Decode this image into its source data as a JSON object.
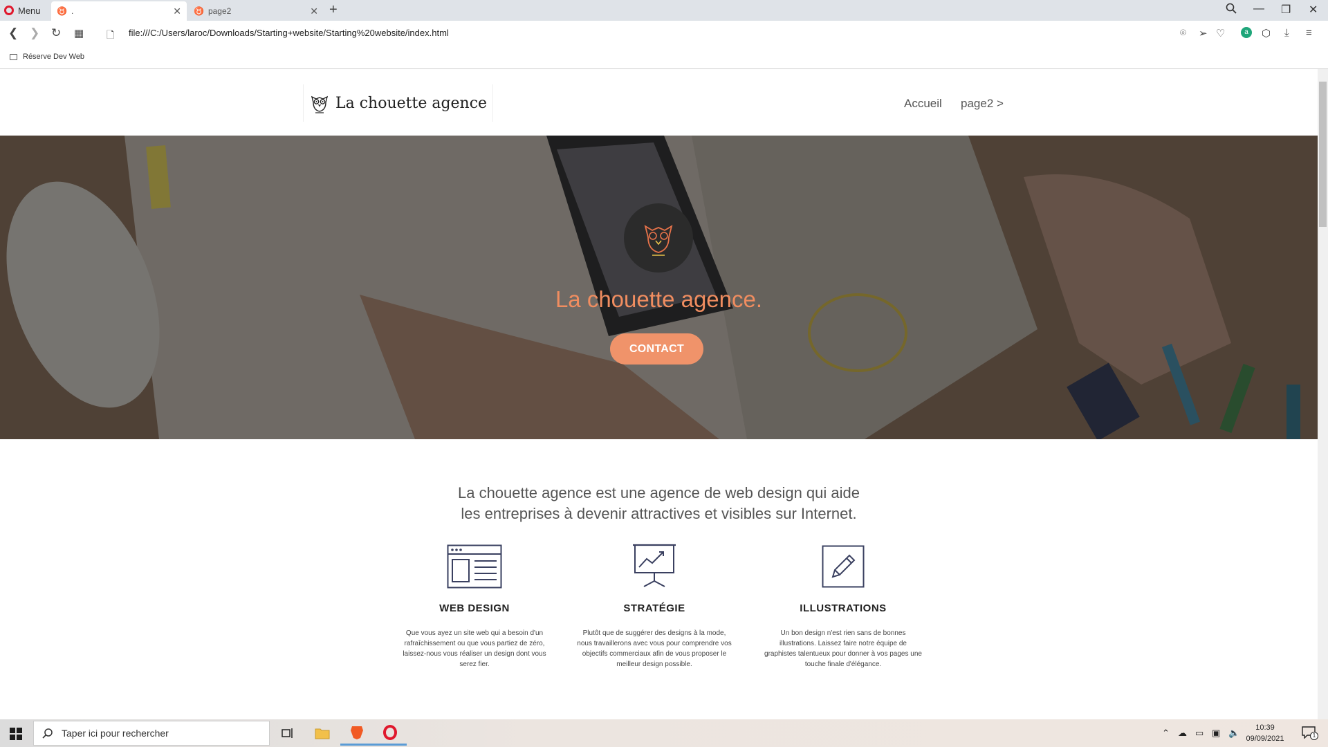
{
  "browser": {
    "menu_label": "Menu",
    "tabs": [
      {
        "title": ".",
        "active": true
      },
      {
        "title": "page2",
        "active": false
      }
    ],
    "url": "file:///C:/Users/laroc/Downloads/Starting+website/Starting%20website/index.html",
    "bookmarks": [
      {
        "label": "Réserve Dev Web"
      }
    ],
    "icons": {
      "back": "back-arrow-icon",
      "forward": "forward-arrow-icon",
      "reload": "reload-icon",
      "tabs_overview": "grid-icon",
      "page": "page-icon",
      "snapshot": "camera-icon",
      "send": "send-icon",
      "bookmark": "heart-icon",
      "vpn": "extension-icon",
      "box": "cube-icon",
      "download": "download-icon",
      "menu": "menu-icon",
      "search": "search-icon",
      "minimize": "minimize-icon",
      "restore": "restore-icon",
      "close": "close-icon"
    }
  },
  "site": {
    "logo_text": "La chouette agence",
    "nav": [
      {
        "label": "Accueil"
      },
      {
        "label": "page2 >"
      }
    ],
    "hero": {
      "title": "La chouette agence.",
      "cta": "CONTACT",
      "accent_color": "#f0936a"
    },
    "intro": {
      "line1": "La chouette agence est une agence de web design qui aide",
      "line2": "les entreprises à devenir attractives et visibles sur Internet."
    },
    "services": [
      {
        "icon": "web-layout-icon",
        "title": "WEB DESIGN",
        "desc": "Que vous ayez un site web qui a besoin d'un rafraîchissement ou que vous partiez de zéro, laissez-nous vous réaliser un design dont vous serez fier."
      },
      {
        "icon": "presentation-chart-icon",
        "title": "STRATÉGIE",
        "desc": "Plutôt que de suggérer des designs à la mode, nous travaillerons avec vous pour comprendre vos objectifs commerciaux afin de vous proposer le meilleur design possible."
      },
      {
        "icon": "pencil-icon",
        "title": "ILLUSTRATIONS",
        "desc": "Un bon design n'est rien sans de bonnes illustrations. Laissez faire notre équipe de graphistes talentueux pour donner à vos pages une touche finale d'élégance."
      }
    ]
  },
  "taskbar": {
    "search_placeholder": "Taper ici pour rechercher",
    "time": "10:39",
    "date": "09/09/2021",
    "notification_count": "1"
  }
}
